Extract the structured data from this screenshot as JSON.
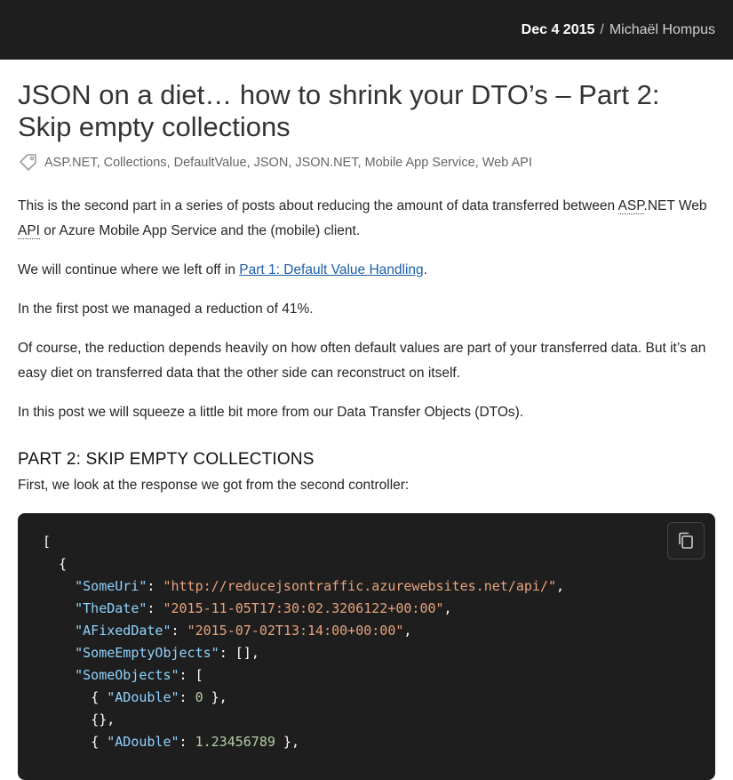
{
  "header": {
    "date": "Dec 4 2015",
    "separator": "/",
    "author": "Michaël Hompus"
  },
  "post": {
    "title": "JSON on a diet… how to shrink your DTO’s – Part 2: Skip empty collections",
    "tags": [
      "ASP.NET",
      "Collections",
      "DefaultValue",
      "JSON",
      "JSON.NET",
      "Mobile App Service",
      "Web API"
    ],
    "tag_icon": "tag-icon",
    "intro_p1_a": "This is the second part in a series of posts about reducing the amount of data transferred between ",
    "intro_p1_abbr1": "ASP",
    "intro_p1_b": ".NET Web ",
    "intro_p1_abbr2": "API",
    "intro_p1_c": " or Azure Mobile App Service and the (mobile) client.",
    "intro_p2_a": "We will continue where we left off in ",
    "intro_p2_link": "Part 1: Default Value Handling",
    "intro_p2_b": ".",
    "intro_p3": "In the first post we managed a reduction of 41%.",
    "intro_p4": "Of course, the reduction depends heavily on how often default values are part of your transferred data. But it’s an easy diet on transferred data that the other side can reconstruct on itself.",
    "intro_p5": "In this post we will squeeze a little bit more from our Data Transfer Objects (DTOs).",
    "section_heading": "PART 2: SKIP EMPTY COLLECTIONS",
    "section_p1": "First, we look at the response we got from the second controller:"
  },
  "code": {
    "copy_icon": "copy-icon",
    "lines": {
      "l1": "[",
      "l2": "  {",
      "l3_key": "\"SomeUri\"",
      "l3_val": "\"http://reducejsontraffic.azurewebsites.net/api/\"",
      "l4_key": "\"TheDate\"",
      "l4_val": "\"2015-11-05T17:30:02.3206122+00:00\"",
      "l5_key": "\"AFixedDate\"",
      "l5_val": "\"2015-07-02T13:14:00+00:00\"",
      "l6_key": "\"SomeEmptyObjects\"",
      "l6_val": "[]",
      "l7_key": "\"SomeObjects\"",
      "l7_val": "[",
      "l8_key": "\"ADouble\"",
      "l8_val": "0",
      "l9": "{}",
      "l10_key": "\"ADouble\"",
      "l10_val": "1.23456789"
    }
  }
}
